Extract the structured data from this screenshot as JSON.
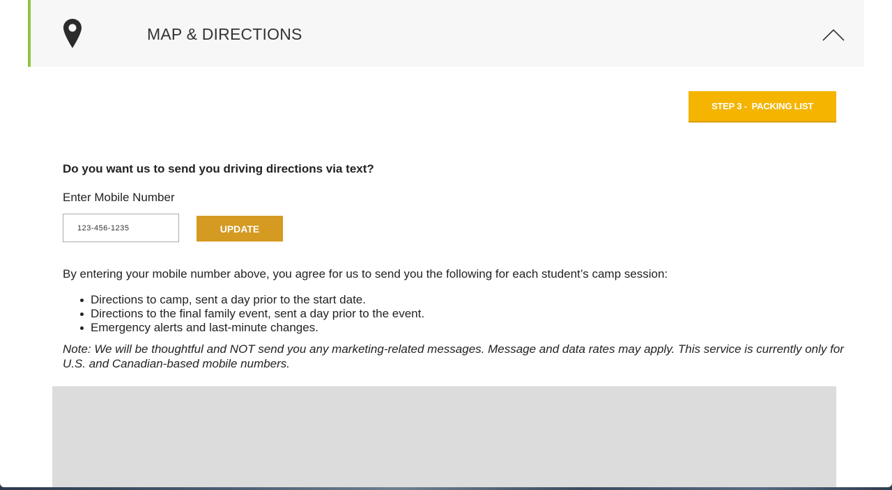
{
  "header": {
    "title": "MAP & DIRECTIONS",
    "icon": "map-pin-icon",
    "toggle_icon": "chevron-up-icon"
  },
  "step_button": {
    "label": "STEP 3 -  PACKING LIST"
  },
  "sms_form": {
    "question": "Do you want us to send you driving directions via text?",
    "mobile_label": "Enter Mobile Number",
    "mobile_value": "123-456-1235",
    "update_label": "UPDATE"
  },
  "agreement": {
    "intro": "By entering your mobile number above, you agree for us to send you the following for each student’s camp session:",
    "items": [
      "Directions to camp, sent a day prior to the start date.",
      "Directions to the final family event, sent a day prior to the event.",
      "Emergency alerts and last-minute changes."
    ],
    "note": "Note: We will be thoughtful and NOT send you any marketing-related messages. Message and data rates may apply. This service is currently only for U.S. and Canadian-based mobile numbers."
  },
  "colors": {
    "accent_green": "#8cc63f",
    "step_button": "#f5b400",
    "update_button": "#d49a22",
    "map_placeholder": "#dcdcdc"
  }
}
